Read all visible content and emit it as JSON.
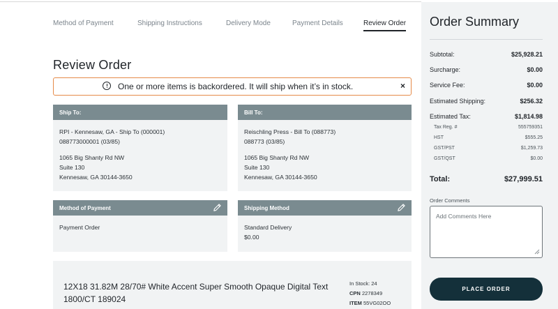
{
  "steps": [
    "Method of Payment",
    "Shipping Instructions",
    "Delivery Mode",
    "Payment Details",
    "Review Order"
  ],
  "page_title": "Review Order",
  "alert": {
    "text": "One or more items is backordered. It will ship when it’s in stock.",
    "close": "×"
  },
  "ship_to": {
    "heading": "Ship To:",
    "line1": "RPI - Kennesaw, GA - Ship To (000001)",
    "line2": "088773000001 (03/85)",
    "address1": "1065 Big Shanty Rd NW",
    "address2": "Suite 130",
    "address3": "Kennesaw, GA 30144-3650"
  },
  "bill_to": {
    "heading": "Bill To:",
    "line1": "Reischling Press - Bill To (088773)",
    "line2": "088773 (03/85)",
    "address1": "1065 Big Shanty Rd NW",
    "address2": "Suite 130",
    "address3": "Kennesaw, GA 30144-3650"
  },
  "method_of_payment": {
    "heading": "Method of Payment",
    "value": "Payment Order"
  },
  "shipping_method": {
    "heading": "Shipping Method",
    "value": "Standard Delivery",
    "price": "$0.00"
  },
  "product": {
    "name": "12X18 31.82M 28/70# White Accent Super Smooth Opaque Digital Text 1800/CT 189024",
    "in_stock": "In Stock: 24",
    "cpn_label": "CPN",
    "cpn": "2278349",
    "item_label": "ITEM",
    "item": "55VG02OO"
  },
  "summary": {
    "title": "Order Summary",
    "subtotal": {
      "label": "Subtotal:",
      "value": "$25,928.21"
    },
    "surcharge": {
      "label": "Surcharge:",
      "value": "$0.00"
    },
    "service_fee": {
      "label": "Service Fee:",
      "value": "$0.00"
    },
    "estimated_shipping": {
      "label": "Estimated Shipping:",
      "value": "$256.32"
    },
    "estimated_tax": {
      "label": "Estimated Tax:",
      "value": "$1,814.98"
    },
    "tax_reg": {
      "label": "Tax Reg. #",
      "value": "555759351"
    },
    "hst": {
      "label": "HST",
      "value": "$555.25"
    },
    "gst_pst": {
      "label": "GST/PST",
      "value": "$1,259.73"
    },
    "gst_qst": {
      "label": "GST/QST",
      "value": "$0.00"
    },
    "total": {
      "label": "Total:",
      "value": "$27,999.51"
    },
    "comments_label": "Order Comments",
    "comments_placeholder": "Add Comments Here",
    "place_order": "PLACE ORDER"
  },
  "icons": {
    "alert": "info-circle-icon",
    "edit": "pencil-icon",
    "close": "close-icon"
  }
}
